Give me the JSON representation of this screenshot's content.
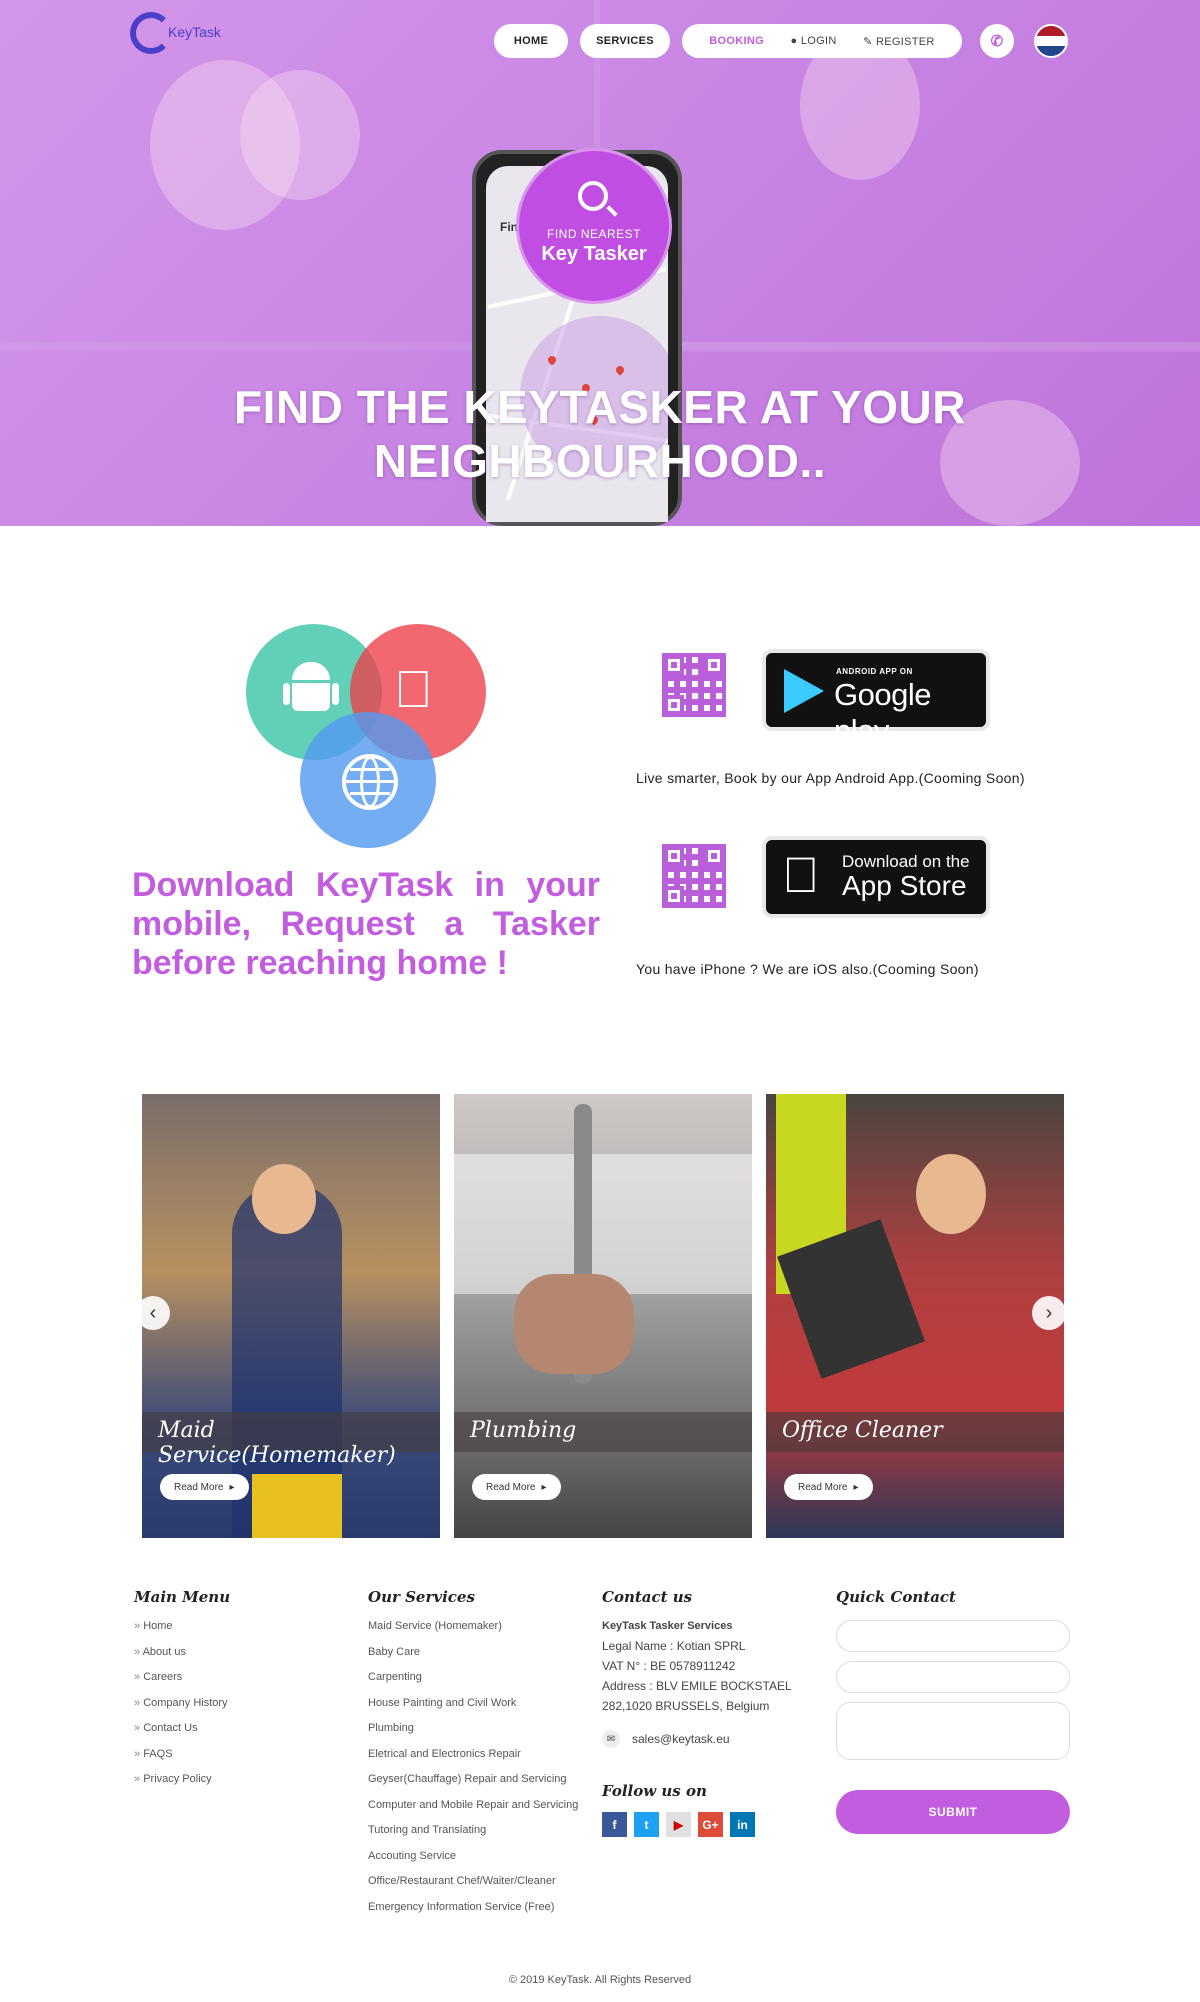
{
  "brand": {
    "logo_text": "KeyTask"
  },
  "nav": {
    "home": "HOME",
    "services": "SERVICES",
    "booking": "BOOKING",
    "login": "LOGIN",
    "register": "REGISTER"
  },
  "hero": {
    "find_line1": "FIND NEAREST",
    "find_line2": "Key Tasker",
    "phone_search_text": "Find",
    "title": "FIND THE KEYTASKER AT YOUR NEIGHBOURHOOD.."
  },
  "download": {
    "headline": "Download KeyTask in your mobile, Request a Tasker before reaching home !",
    "google_small": "ANDROID APP ON",
    "google_big": "Google play",
    "android_caption": "Live smarter, Book by our App Android App.(Cooming Soon)",
    "apple_small": "Download on the",
    "apple_big": "App Store",
    "ios_caption": "You have iPhone ? We are iOS also.(Cooming Soon)"
  },
  "carousel": {
    "cards": [
      {
        "title": "Maid Service(Homemaker)",
        "button": "Read More"
      },
      {
        "title": "Plumbing",
        "button": "Read More"
      },
      {
        "title": "Office Cleaner",
        "button": "Read More"
      }
    ]
  },
  "footer": {
    "main_menu_title": "Main Menu",
    "main_menu": [
      "Home",
      "About us",
      "Careers",
      "Company History",
      "Contact Us",
      "FAQS",
      "Privacy Policy"
    ],
    "services_title": "Our Services",
    "services": [
      "Maid Service (Homemaker)",
      "Baby Care",
      "Carpenting",
      "House Painting and Civil Work",
      "Plumbing",
      "Eletrical and Electronics Repair",
      "Geyser(Chauffage) Repair and Servicing",
      "Computer and Mobile Repair and Servicing",
      "Tutoring and Translating",
      "Accouting Service",
      "Office/Restaurant Chef/Waiter/Cleaner",
      "Emergency Information Service (Free)"
    ],
    "contact_title": "Contact us",
    "contact_company": "KeyTask Tasker Services",
    "contact_legal": "Legal Name : Kotian SPRL",
    "contact_vat": "VAT N° : BE 0578911242",
    "contact_address1": "Address : BLV EMILE BOCKSTAEL",
    "contact_address2": "282,1020 BRUSSELS, Belgium",
    "contact_email": "sales@keytask.eu",
    "follow_title": "Follow us on",
    "quick_title": "Quick Contact",
    "submit": "SUBMIT",
    "copyright": "© 2019 KeyTask. All Rights Reserved"
  },
  "colors": {
    "accent": "#c35de0",
    "brand_blue": "#4b3fc9"
  },
  "icons": [
    "phone-icon",
    "user-icon",
    "edit-icon",
    "search-icon",
    "android-icon",
    "apple-icon",
    "globe-icon",
    "envelope-icon",
    "facebook-icon",
    "twitter-icon",
    "youtube-icon",
    "google-plus-icon",
    "linkedin-icon",
    "chevron-left-icon",
    "chevron-right-icon"
  ]
}
